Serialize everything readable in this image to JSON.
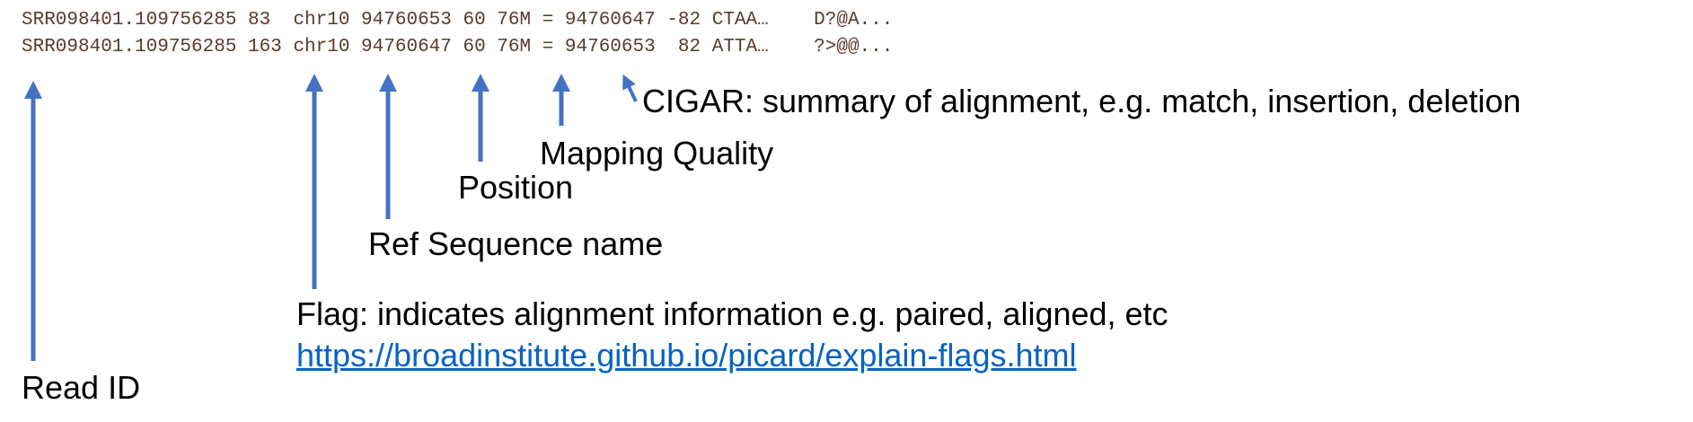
{
  "sam_lines": [
    "SRR098401.109756285 83  chr10 94760653 60 76M = 94760647 -82 CTAA…    D?@A...",
    "SRR098401.109756285 163 chr10 94760647 60 76M = 94760653  82 ATTA…    ?>@@..."
  ],
  "labels": {
    "cigar": "CIGAR: summary of alignment, e.g. match, insertion, deletion",
    "mapping_quality": "Mapping Quality",
    "position": "Position",
    "ref_sequence": "Ref Sequence name",
    "flag": "Flag: indicates alignment information e.g. paired, aligned, etc",
    "read_id": "Read ID"
  },
  "flag_link": {
    "text": "https://broadinstitute.github.io/picard/explain-flags.html"
  },
  "colors": {
    "arrow": "#4472c4",
    "link": "#0563c1",
    "sam_text": "#5a3a2c"
  },
  "arrows": [
    {
      "points_to": "read-id",
      "icon": "arrow-up-icon"
    },
    {
      "points_to": "flag",
      "icon": "arrow-up-icon"
    },
    {
      "points_to": "ref-sequence-name",
      "icon": "arrow-up-icon"
    },
    {
      "points_to": "position",
      "icon": "arrow-up-icon"
    },
    {
      "points_to": "mapping-quality",
      "icon": "arrow-up-icon"
    },
    {
      "points_to": "cigar",
      "icon": "arrow-up-icon"
    }
  ]
}
